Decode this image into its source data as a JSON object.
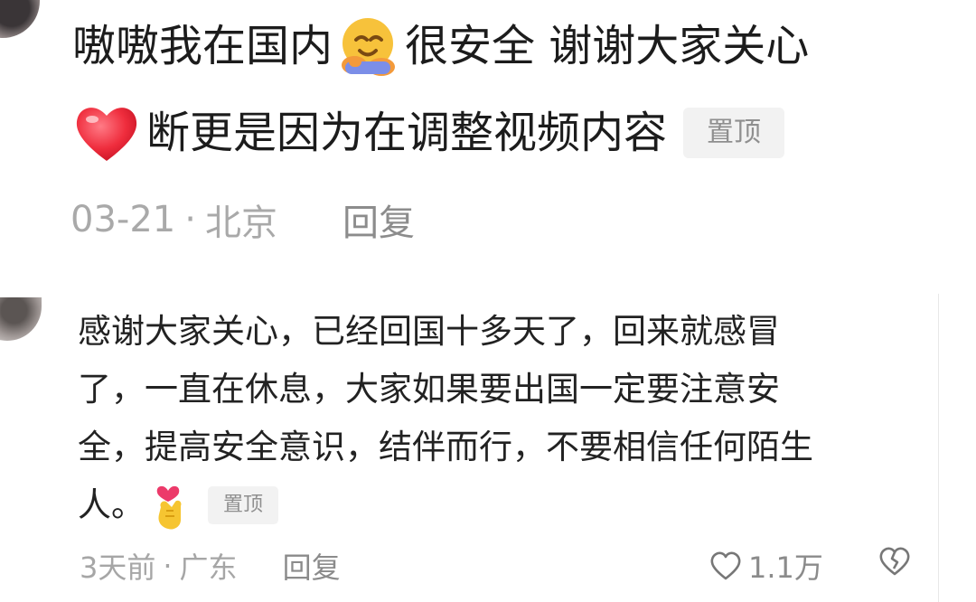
{
  "comment1": {
    "line1_text_a": "嗷嗷我在国内",
    "line1_text_b": "很安全 谢谢大家关心",
    "line2_text": "断更是因为在调整视频内容",
    "pin_label": "置顶",
    "date": "03-21",
    "separator": "·",
    "location": "北京",
    "reply_label": "回复",
    "emoji_1": "hug-emoji",
    "emoji_2": "red-heart-emoji"
  },
  "comment2": {
    "lines": [
      "感谢大家关心，已经回国十多天了，回来就感冒",
      "了，一直在休息，大家如果要出国一定要注意安",
      "全，提高安全意识，结伴而行，不要相信任何陌生",
      "人。"
    ],
    "pin_label": "置顶",
    "time": "3天前",
    "separator": "·",
    "location": "广东",
    "reply_label": "回复",
    "like_count": "1.1万",
    "emoji": "finger-heart-emoji",
    "like_icon": "heart-outline-icon",
    "dislike_icon": "broken-heart-icon"
  }
}
